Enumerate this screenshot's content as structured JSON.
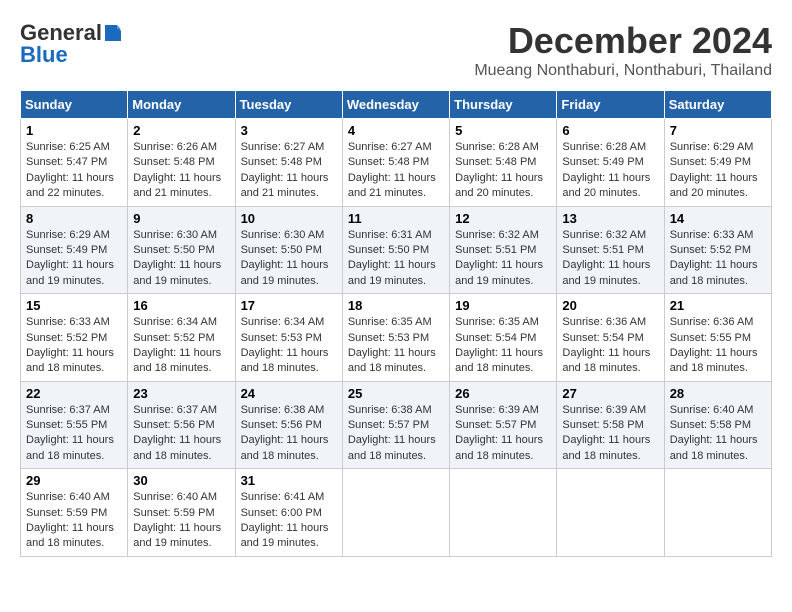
{
  "header": {
    "logo_general": "General",
    "logo_blue": "Blue",
    "month_title": "December 2024",
    "location": "Mueang Nonthaburi, Nonthaburi, Thailand"
  },
  "weekdays": [
    "Sunday",
    "Monday",
    "Tuesday",
    "Wednesday",
    "Thursday",
    "Friday",
    "Saturday"
  ],
  "weeks": [
    [
      {
        "day": "1",
        "info": "Sunrise: 6:25 AM\nSunset: 5:47 PM\nDaylight: 11 hours\nand 22 minutes."
      },
      {
        "day": "2",
        "info": "Sunrise: 6:26 AM\nSunset: 5:48 PM\nDaylight: 11 hours\nand 21 minutes."
      },
      {
        "day": "3",
        "info": "Sunrise: 6:27 AM\nSunset: 5:48 PM\nDaylight: 11 hours\nand 21 minutes."
      },
      {
        "day": "4",
        "info": "Sunrise: 6:27 AM\nSunset: 5:48 PM\nDaylight: 11 hours\nand 21 minutes."
      },
      {
        "day": "5",
        "info": "Sunrise: 6:28 AM\nSunset: 5:48 PM\nDaylight: 11 hours\nand 20 minutes."
      },
      {
        "day": "6",
        "info": "Sunrise: 6:28 AM\nSunset: 5:49 PM\nDaylight: 11 hours\nand 20 minutes."
      },
      {
        "day": "7",
        "info": "Sunrise: 6:29 AM\nSunset: 5:49 PM\nDaylight: 11 hours\nand 20 minutes."
      }
    ],
    [
      {
        "day": "8",
        "info": "Sunrise: 6:29 AM\nSunset: 5:49 PM\nDaylight: 11 hours\nand 19 minutes."
      },
      {
        "day": "9",
        "info": "Sunrise: 6:30 AM\nSunset: 5:50 PM\nDaylight: 11 hours\nand 19 minutes."
      },
      {
        "day": "10",
        "info": "Sunrise: 6:30 AM\nSunset: 5:50 PM\nDaylight: 11 hours\nand 19 minutes."
      },
      {
        "day": "11",
        "info": "Sunrise: 6:31 AM\nSunset: 5:50 PM\nDaylight: 11 hours\nand 19 minutes."
      },
      {
        "day": "12",
        "info": "Sunrise: 6:32 AM\nSunset: 5:51 PM\nDaylight: 11 hours\nand 19 minutes."
      },
      {
        "day": "13",
        "info": "Sunrise: 6:32 AM\nSunset: 5:51 PM\nDaylight: 11 hours\nand 19 minutes."
      },
      {
        "day": "14",
        "info": "Sunrise: 6:33 AM\nSunset: 5:52 PM\nDaylight: 11 hours\nand 18 minutes."
      }
    ],
    [
      {
        "day": "15",
        "info": "Sunrise: 6:33 AM\nSunset: 5:52 PM\nDaylight: 11 hours\nand 18 minutes."
      },
      {
        "day": "16",
        "info": "Sunrise: 6:34 AM\nSunset: 5:52 PM\nDaylight: 11 hours\nand 18 minutes."
      },
      {
        "day": "17",
        "info": "Sunrise: 6:34 AM\nSunset: 5:53 PM\nDaylight: 11 hours\nand 18 minutes."
      },
      {
        "day": "18",
        "info": "Sunrise: 6:35 AM\nSunset: 5:53 PM\nDaylight: 11 hours\nand 18 minutes."
      },
      {
        "day": "19",
        "info": "Sunrise: 6:35 AM\nSunset: 5:54 PM\nDaylight: 11 hours\nand 18 minutes."
      },
      {
        "day": "20",
        "info": "Sunrise: 6:36 AM\nSunset: 5:54 PM\nDaylight: 11 hours\nand 18 minutes."
      },
      {
        "day": "21",
        "info": "Sunrise: 6:36 AM\nSunset: 5:55 PM\nDaylight: 11 hours\nand 18 minutes."
      }
    ],
    [
      {
        "day": "22",
        "info": "Sunrise: 6:37 AM\nSunset: 5:55 PM\nDaylight: 11 hours\nand 18 minutes."
      },
      {
        "day": "23",
        "info": "Sunrise: 6:37 AM\nSunset: 5:56 PM\nDaylight: 11 hours\nand 18 minutes."
      },
      {
        "day": "24",
        "info": "Sunrise: 6:38 AM\nSunset: 5:56 PM\nDaylight: 11 hours\nand 18 minutes."
      },
      {
        "day": "25",
        "info": "Sunrise: 6:38 AM\nSunset: 5:57 PM\nDaylight: 11 hours\nand 18 minutes."
      },
      {
        "day": "26",
        "info": "Sunrise: 6:39 AM\nSunset: 5:57 PM\nDaylight: 11 hours\nand 18 minutes."
      },
      {
        "day": "27",
        "info": "Sunrise: 6:39 AM\nSunset: 5:58 PM\nDaylight: 11 hours\nand 18 minutes."
      },
      {
        "day": "28",
        "info": "Sunrise: 6:40 AM\nSunset: 5:58 PM\nDaylight: 11 hours\nand 18 minutes."
      }
    ],
    [
      {
        "day": "29",
        "info": "Sunrise: 6:40 AM\nSunset: 5:59 PM\nDaylight: 11 hours\nand 18 minutes."
      },
      {
        "day": "30",
        "info": "Sunrise: 6:40 AM\nSunset: 5:59 PM\nDaylight: 11 hours\nand 19 minutes."
      },
      {
        "day": "31",
        "info": "Sunrise: 6:41 AM\nSunset: 6:00 PM\nDaylight: 11 hours\nand 19 minutes."
      },
      {
        "day": "",
        "info": ""
      },
      {
        "day": "",
        "info": ""
      },
      {
        "day": "",
        "info": ""
      },
      {
        "day": "",
        "info": ""
      }
    ]
  ]
}
